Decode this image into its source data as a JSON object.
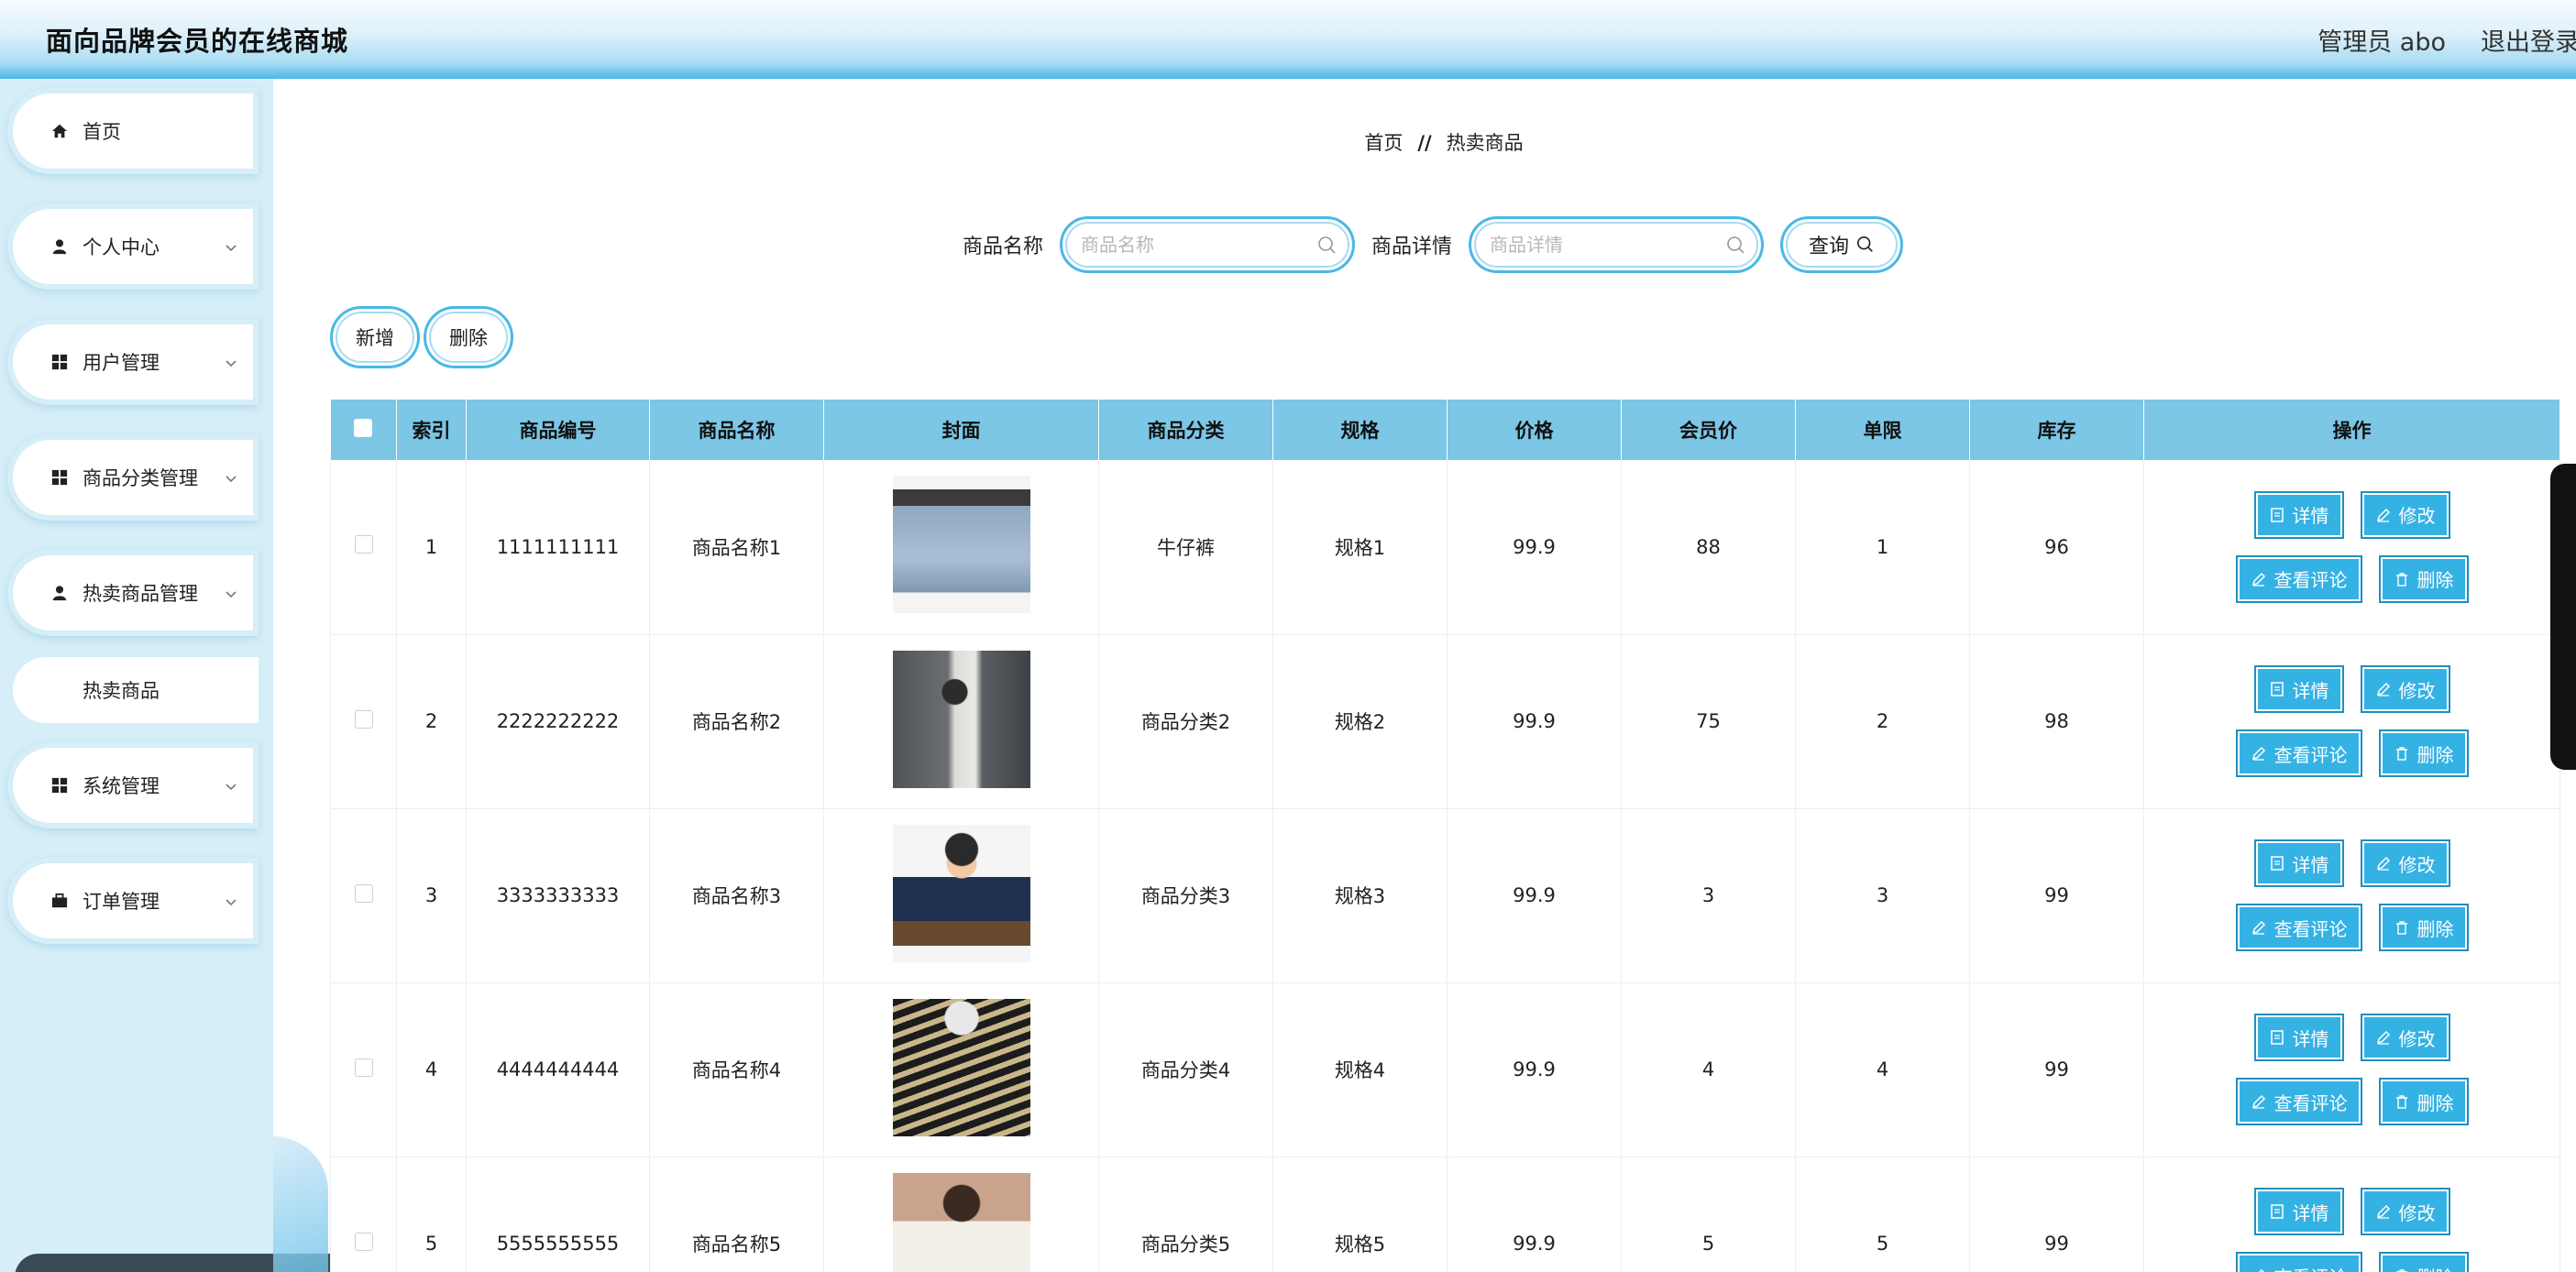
{
  "header": {
    "title": "面向品牌会员的在线商城",
    "user": "管理员 abo",
    "logout": "退出登录"
  },
  "sidebar": {
    "items": [
      {
        "label": "首页",
        "icon": "home-icon"
      },
      {
        "label": "个人中心",
        "icon": "person-icon"
      },
      {
        "label": "用户管理",
        "icon": "grid-icon"
      },
      {
        "label": "商品分类管理",
        "icon": "grid-icon"
      },
      {
        "label": "热卖商品管理",
        "icon": "person-icon"
      },
      {
        "label": "系统管理",
        "icon": "grid-icon"
      },
      {
        "label": "订单管理",
        "icon": "briefcase-icon"
      }
    ],
    "submenu": {
      "label": "热卖商品"
    }
  },
  "breadcrumb": {
    "home": "首页",
    "separator": "//",
    "current": "热卖商品"
  },
  "search": {
    "name_label": "商品名称",
    "name_placeholder": "商品名称",
    "detail_label": "商品详情",
    "detail_placeholder": "商品详情",
    "query": "查询"
  },
  "ops": {
    "add": "新增",
    "delete": "删除"
  },
  "table": {
    "headers": [
      "索引",
      "商品编号",
      "商品名称",
      "封面",
      "商品分类",
      "规格",
      "价格",
      "会员价",
      "单限",
      "库存",
      "操作"
    ],
    "actions": {
      "detail": "详情",
      "edit": "修改",
      "comments": "查看评论",
      "delete": "删除"
    },
    "rows": [
      {
        "index": "1",
        "code": "1111111111",
        "name": "商品名称1",
        "category": "牛仔裤",
        "spec": "规格1",
        "price": "99.9",
        "member_price": "88",
        "limit": "1",
        "stock": "96"
      },
      {
        "index": "2",
        "code": "2222222222",
        "name": "商品名称2",
        "category": "商品分类2",
        "spec": "规格2",
        "price": "99.9",
        "member_price": "75",
        "limit": "2",
        "stock": "98"
      },
      {
        "index": "3",
        "code": "3333333333",
        "name": "商品名称3",
        "category": "商品分类3",
        "spec": "规格3",
        "price": "99.9",
        "member_price": "3",
        "limit": "3",
        "stock": "99"
      },
      {
        "index": "4",
        "code": "4444444444",
        "name": "商品名称4",
        "category": "商品分类4",
        "spec": "规格4",
        "price": "99.9",
        "member_price": "4",
        "limit": "4",
        "stock": "99"
      },
      {
        "index": "5",
        "code": "5555555555",
        "name": "商品名称5",
        "category": "商品分类5",
        "spec": "规格5",
        "price": "99.9",
        "member_price": "5",
        "limit": "5",
        "stock": "99"
      }
    ]
  },
  "colors": {
    "accent": "#35b2e4",
    "header_bg": "#7cc6e6",
    "sidebar_bg": "#d5eef8"
  }
}
